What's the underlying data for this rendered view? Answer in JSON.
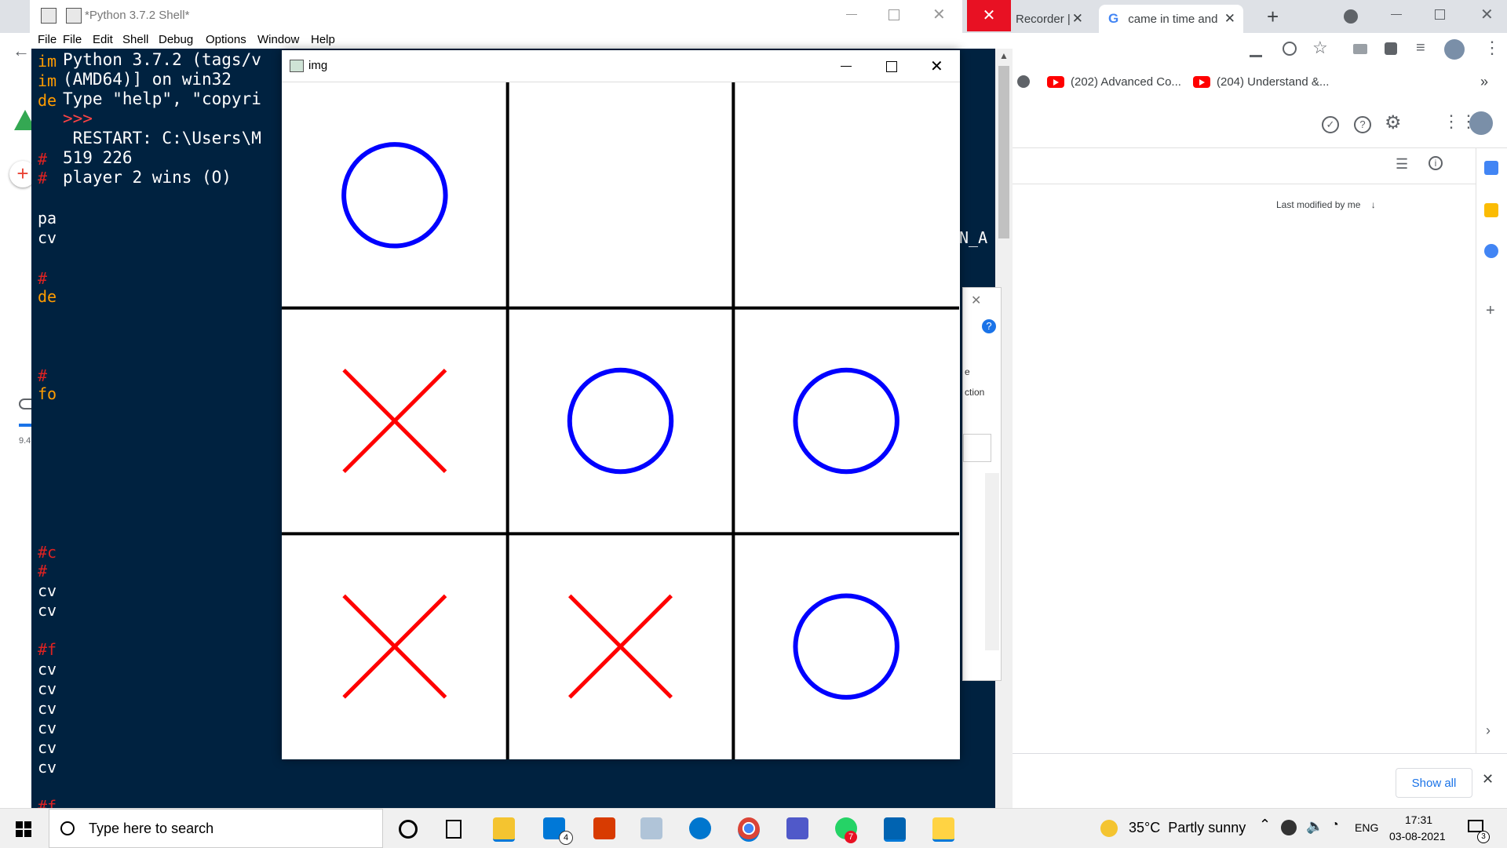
{
  "chrome": {
    "tabs": [
      {
        "label": "Recorder |",
        "close": "✕"
      },
      {
        "label": "came in time and",
        "close": "✕"
      }
    ],
    "new_tab": "+",
    "bookmarks": [
      "(202) Advanced Co...",
      "(204) Understand &..."
    ],
    "bookmarks_more": "»",
    "drive": {
      "last_modified_label": "Last modified by me"
    },
    "download_bar": {
      "show_all": "Show all",
      "close": "✕"
    }
  },
  "left_strip": {
    "storage_text": "9.4"
  },
  "shell": {
    "title": "*Python 3.7.2 Shell*",
    "menu": [
      "File",
      "Edit",
      "Shell",
      "Debug",
      "Options",
      "Window",
      "Help"
    ],
    "lines": [
      "Python 3.7.2 (tags/v",
      "(AMD64)] on win32",
      "Type \"help\", \"copyri",
      ">>>",
      " RESTART: C:\\Users\\M",
      "519 226",
      "player 2 wins (O)"
    ],
    "menu_file_prefix": "File"
  },
  "editor": {
    "fragments": [
      "im",
      "im",
      "de",
      "#",
      "#",
      "pa",
      "cv",
      "#",
      "de",
      "#",
      "fo",
      "#c",
      "#",
      "cv",
      "cv",
      "#f",
      "cv",
      "cv",
      "cv",
      "cv",
      "cv",
      "cv",
      "#f"
    ],
    "right_fragment": "N_A"
  },
  "dialog_fragments": {
    "line1": "e",
    "line2": "ction",
    "help": "?"
  },
  "img_window": {
    "title": "img",
    "board": [
      [
        "O",
        "",
        ""
      ],
      [
        "X",
        "O",
        "O"
      ],
      [
        "X",
        "X",
        "O"
      ]
    ],
    "colors": {
      "o": "#0000ff",
      "x": "#ff0000",
      "grid": "#000000"
    }
  },
  "taskbar": {
    "search_placeholder": "Type here to search",
    "mail_badge": "4",
    "whatsapp_badge": "7",
    "weather": "35°C  Partly sunny",
    "lang": "ENG",
    "time": "17:31",
    "date": "03-08-2021",
    "notif_count": "3"
  }
}
